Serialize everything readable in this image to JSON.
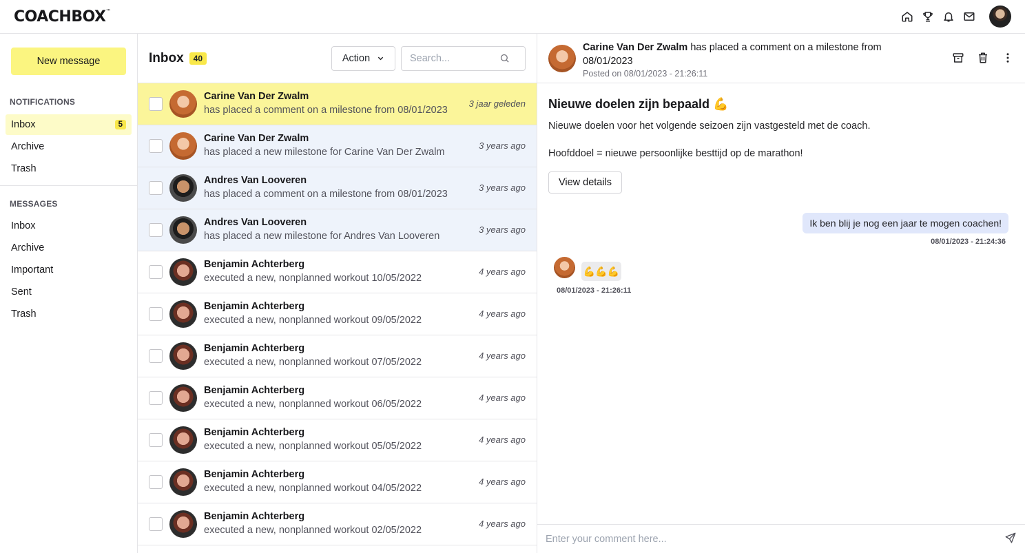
{
  "app": {
    "logo": "COACHBOX",
    "logo_mark": "™"
  },
  "topbar": {
    "icons": [
      "home-icon",
      "trophy-icon",
      "bell-icon",
      "mail-icon"
    ]
  },
  "sidebar": {
    "new_message": "New message",
    "notifications_title": "NOTIFICATIONS",
    "notifications": [
      {
        "label": "Inbox",
        "badge": "5"
      },
      {
        "label": "Archive"
      },
      {
        "label": "Trash"
      }
    ],
    "messages_title": "MESSAGES",
    "messages": [
      {
        "label": "Inbox"
      },
      {
        "label": "Archive"
      },
      {
        "label": "Important"
      },
      {
        "label": "Sent"
      },
      {
        "label": "Trash"
      }
    ]
  },
  "list": {
    "title": "Inbox",
    "count": "40",
    "action": "Action",
    "search_placeholder": "Search...",
    "rows": [
      {
        "name": "Carine Van Der Zwalm",
        "text": "has placed a comment on a milestone from 08/01/2023",
        "time": "3 jaar geleden"
      },
      {
        "name": "Carine Van Der Zwalm",
        "text": "has placed a new milestone for Carine Van Der Zwalm",
        "time": "3 years ago"
      },
      {
        "name": "Andres Van Looveren",
        "text": "has placed a comment on a milestone from 08/01/2023",
        "time": "3 years ago"
      },
      {
        "name": "Andres Van Looveren",
        "text": "has placed a new milestone for Andres Van Looveren",
        "time": "3 years ago"
      },
      {
        "name": "Benjamin Achterberg",
        "text": "executed a new, nonplanned workout 10/05/2022",
        "time": "4 years ago"
      },
      {
        "name": "Benjamin Achterberg",
        "text": "executed a new, nonplanned workout 09/05/2022",
        "time": "4 years ago"
      },
      {
        "name": "Benjamin Achterberg",
        "text": "executed a new, nonplanned workout 07/05/2022",
        "time": "4 years ago"
      },
      {
        "name": "Benjamin Achterberg",
        "text": "executed a new, nonplanned workout 06/05/2022",
        "time": "4 years ago"
      },
      {
        "name": "Benjamin Achterberg",
        "text": "executed a new, nonplanned workout 05/05/2022",
        "time": "4 years ago"
      },
      {
        "name": "Benjamin Achterberg",
        "text": "executed a new, nonplanned workout 04/05/2022",
        "time": "4 years ago"
      },
      {
        "name": "Benjamin Achterberg",
        "text": "executed a new, nonplanned workout 02/05/2022",
        "time": "4 years ago"
      }
    ]
  },
  "detail": {
    "sender": "Carine Van Der Zwalm",
    "header_text": " has placed a comment on a milestone from 08/01/2023",
    "posted": "Posted on 08/01/2023 - 21:26:11",
    "title": "Nieuwe doelen zijn bepaald 💪",
    "body1": "Nieuwe doelen voor het volgende seizoen zijn vastgesteld met de coach.",
    "body2": "Hoofddoel = nieuwe persoonlijke besttijd op de marathon!",
    "view_details": "View details",
    "messages": [
      {
        "text": "Ik ben blij je nog een jaar te mogen coachen!",
        "time": "08/01/2023 - 21:24:36"
      },
      {
        "text": "💪💪💪",
        "time": "08/01/2023 - 21:26:11"
      }
    ],
    "comment_placeholder": "Enter your comment here..."
  }
}
